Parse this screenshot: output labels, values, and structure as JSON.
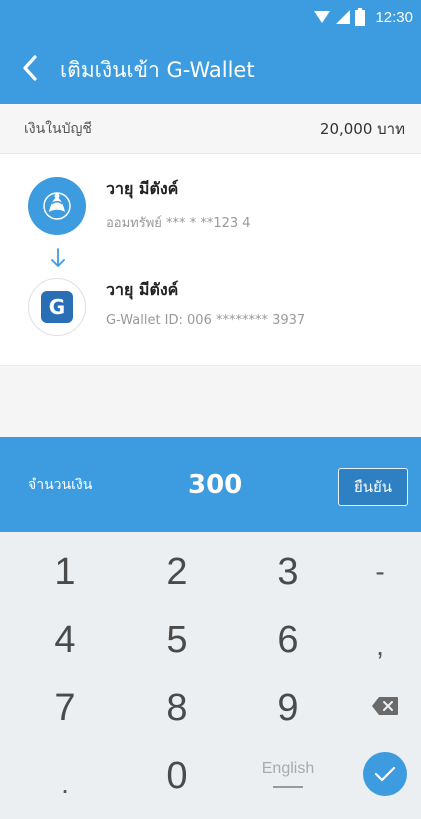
{
  "status_bar": {
    "time": "12:30",
    "icons": [
      "wifi-icon",
      "signal-icon",
      "battery-icon"
    ]
  },
  "app_bar": {
    "title": "เติมเงินเข้า G-Wallet",
    "back_icon": "chevron-left-icon"
  },
  "balance": {
    "label": "เงินในบัญชี",
    "value": "20,000 บาท"
  },
  "transfer": {
    "from": {
      "name": "วายุ มีตังค์",
      "detail": "ออมทรัพย์ *** * **123 4",
      "icon": "bank-logo-icon"
    },
    "arrow_icon": "arrow-down-icon",
    "to": {
      "name": "วายุ มีตังค์",
      "detail": "G-Wallet ID: 006 ******** 3937",
      "logo_letter": "G"
    }
  },
  "amount": {
    "label": "จำนวนเงิน",
    "value": "300",
    "confirm_label": "ยืนยัน"
  },
  "keypad": {
    "keys": [
      "1",
      "2",
      "3",
      "-",
      "4",
      "5",
      "6",
      ",",
      "7",
      "8",
      "9",
      "backspace",
      ".",
      "0",
      "English",
      "done"
    ],
    "k1": "1",
    "k2": "2",
    "k3": "3",
    "k_dash": "-",
    "k4": "4",
    "k5": "5",
    "k6": "6",
    "k_comma": ",",
    "k7": "7",
    "k8": "8",
    "k9": "9",
    "k_dot": ".",
    "k0": "0",
    "k_lang": "English"
  },
  "colors": {
    "primary": "#3d9be0",
    "confirm_button": "#2f80c2",
    "keypad_bg": "#eceff1"
  }
}
